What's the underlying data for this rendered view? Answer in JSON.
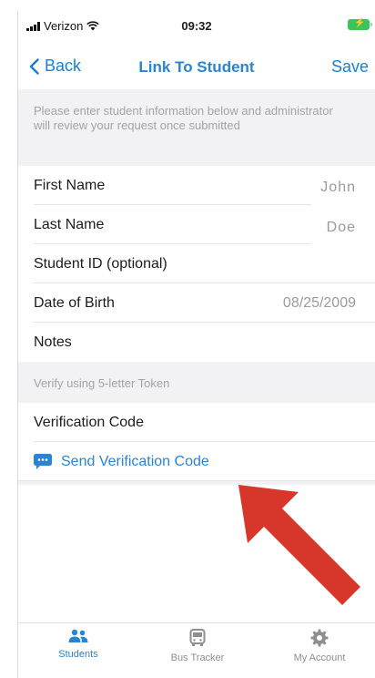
{
  "status_bar": {
    "carrier": "Verizon",
    "time": "09:32"
  },
  "nav": {
    "back_label": "Back",
    "title": "Link To Student",
    "save_label": "Save"
  },
  "form": {
    "intro_text": "Please enter student information below and administrator will review your request once submitted",
    "fields": [
      {
        "label": "First Name",
        "value": "John"
      },
      {
        "label": "Last Name",
        "value": "Doe"
      },
      {
        "label": "Student ID (optional)",
        "value": ""
      },
      {
        "label": "Date of Birth",
        "value": "08/25/2009"
      },
      {
        "label": "Notes",
        "value": ""
      }
    ],
    "verify_section_header": "Verify using 5-letter Token",
    "verification_code_label": "Verification Code",
    "send_code_label": "Send Verification Code"
  },
  "tabs": [
    {
      "label": "Students",
      "icon": "people-icon",
      "active": true
    },
    {
      "label": "Bus Tracker",
      "icon": "bus-icon",
      "active": false
    },
    {
      "label": "My Account",
      "icon": "gear-icon",
      "active": false
    }
  ],
  "colors": {
    "accent": "#2b84d1",
    "annotation_arrow": "#d7372b",
    "battery": "#3ac45b"
  }
}
